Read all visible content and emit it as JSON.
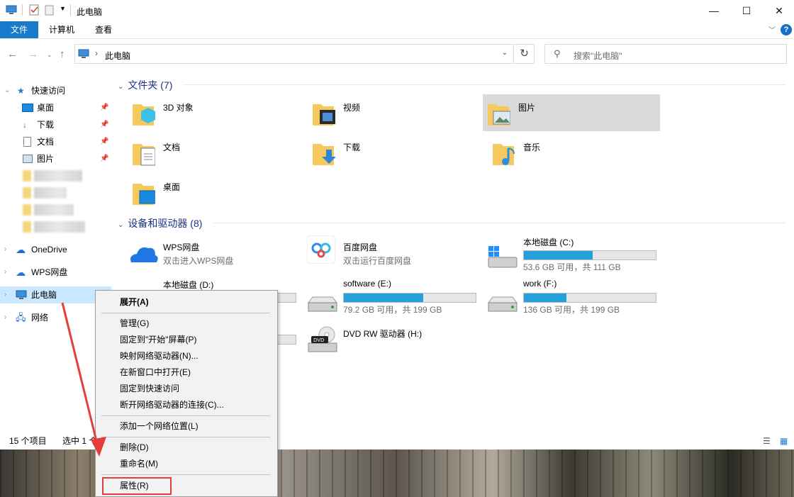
{
  "window": {
    "title": "此电脑",
    "minimize": "—",
    "maximize": "☐",
    "close": "✕"
  },
  "ribbon": {
    "tabs": [
      "文件",
      "计算机",
      "查看"
    ],
    "help": "?"
  },
  "address": {
    "path": "此电脑",
    "search_placeholder": "搜索\"此电脑\""
  },
  "nav": {
    "quick_access": "快速访问",
    "pinned": [
      "桌面",
      "下载",
      "文档",
      "图片"
    ],
    "roots": [
      "OneDrive",
      "WPS网盘",
      "此电脑",
      "网络"
    ]
  },
  "groups": {
    "folders_header": "文件夹 (7)",
    "drives_header": "设备和驱动器 (8)"
  },
  "folders": [
    "3D 对象",
    "视频",
    "图片",
    "文档",
    "下载",
    "音乐",
    "桌面"
  ],
  "drives": [
    {
      "name": "WPS网盘",
      "sub": "双击进入WPS网盘"
    },
    {
      "name": "百度网盘",
      "sub": "双击运行百度网盘"
    },
    {
      "name": "本地磁盘 (C:)",
      "sub": "53.6 GB 可用，共 111 GB",
      "used_fraction": 0.52
    },
    {
      "name": "本地磁盘 (D:)",
      "sub": ""
    },
    {
      "name": "software (E:)",
      "sub": "79.2 GB 可用，共 199 GB",
      "used_fraction": 0.6
    },
    {
      "name": "work (F:)",
      "sub": "136 GB 可用，共 199 GB",
      "used_fraction": 0.32
    },
    {
      "name": "DVD RW 驱动器 (H:)",
      "sub": ""
    }
  ],
  "status": {
    "count": "15 个项目",
    "selected": "选中 1 个"
  },
  "context_menu": {
    "items": [
      "展开(A)",
      "管理(G)",
      "固定到\"开始\"屏幕(P)",
      "映射网络驱动器(N)...",
      "在新窗口中打开(E)",
      "固定到快速访问",
      "断开网络驱动器的连接(C)...",
      "添加一个网络位置(L)",
      "删除(D)",
      "重命名(M)",
      "属性(R)"
    ]
  },
  "colors": {
    "accent": "#1979ca",
    "drive_bar": "#26a0da",
    "highlight": "#e63c3c",
    "arrow": "#e63c3c"
  }
}
